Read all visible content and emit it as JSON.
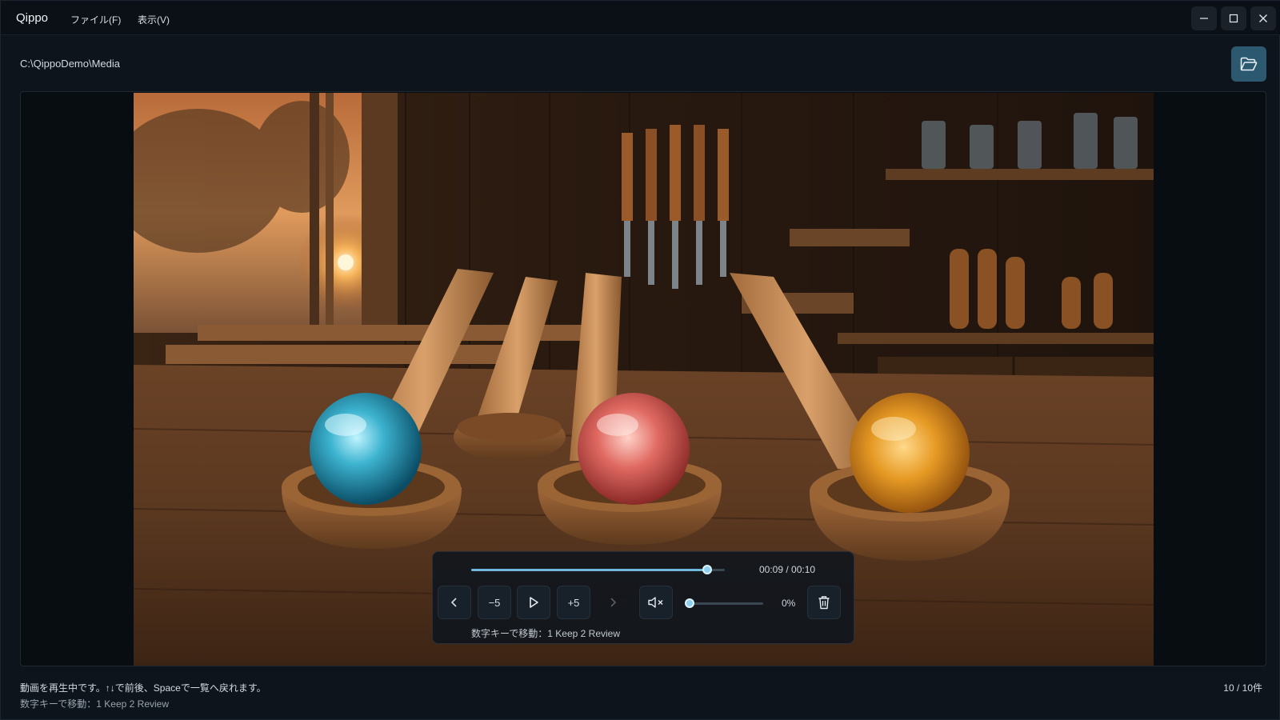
{
  "titlebar": {
    "app_name": "Qippo",
    "menu": {
      "file": "ファイル(F)",
      "view": "表示(V)"
    },
    "buttons": {
      "minimize": "minimize-icon",
      "maximize": "maximize-icon",
      "close": "close-icon"
    }
  },
  "location": {
    "path": "C:\\QippoDemo\\Media",
    "open_folder_icon": "folder-open-icon"
  },
  "player": {
    "progress": 0.93,
    "time": "00:09 / 00:10",
    "buttons": {
      "prev": "chevron-left-icon",
      "back5": "−5",
      "play": "play-icon",
      "fwd5": "+5",
      "next": "chevron-right-icon",
      "mute": "volume-muted-icon",
      "delete": "trash-icon"
    },
    "volume": 0,
    "volume_label": "0%",
    "key_hint": "数字キーで移動：1 Keep  2 Review"
  },
  "status": {
    "message": "動画を再生中です。↑↓で前後、Spaceで一覧へ戻れます。",
    "key_hint": "数字キーで移動：1 Keep  2 Review",
    "count": "10 / 10件"
  },
  "colors": {
    "accent": "#6fb8db",
    "folder_button": "#2c5870",
    "background": "#0d141b"
  }
}
